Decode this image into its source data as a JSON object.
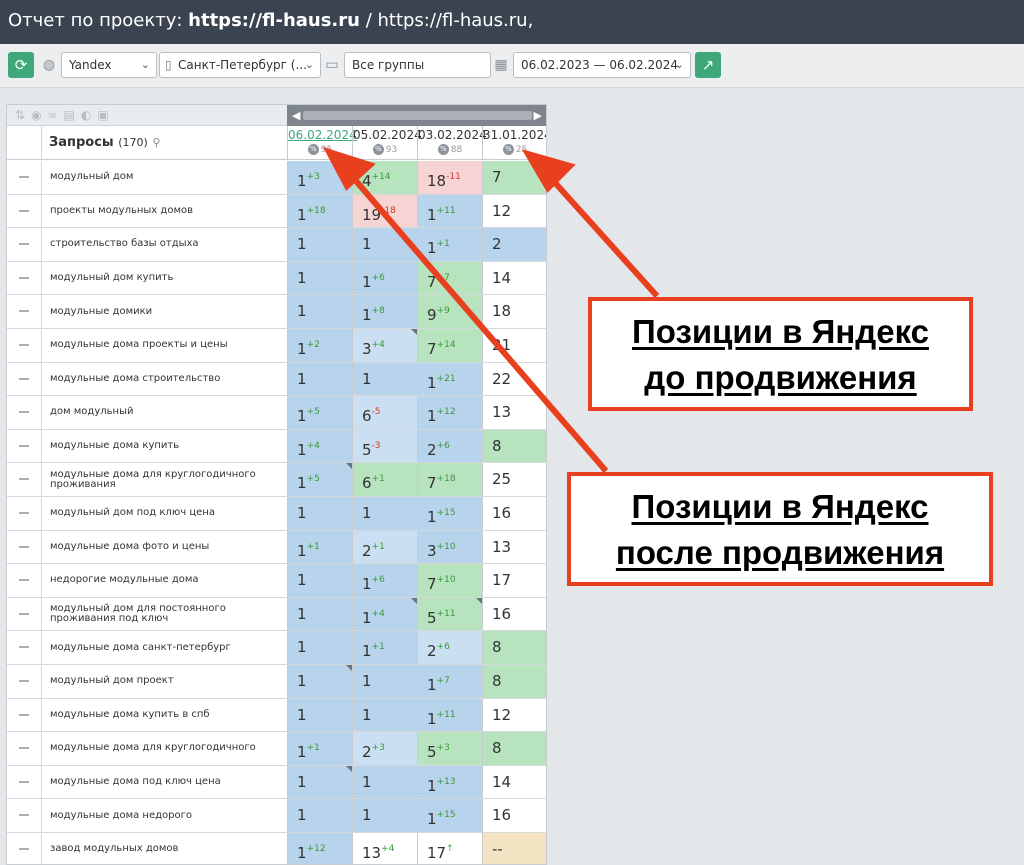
{
  "header": {
    "prefix": "Отчет по проекту: ",
    "project_bold": "https://fl-haus.ru",
    "project_rest": " / https://fl-haus.ru,"
  },
  "toolbar": {
    "search_engine": "Yandex",
    "region": "Санкт-Петербург (...",
    "group": "Все группы",
    "date_range": "06.02.2023 — 06.02.2024"
  },
  "table": {
    "query_header": "Запросы",
    "query_count": "(170)",
    "dates": [
      {
        "date": "06.02.2024",
        "pct": "95"
      },
      {
        "date": "05.02.2024",
        "pct": "93"
      },
      {
        "date": "03.02.2024",
        "pct": "88"
      },
      {
        "date": "31.01.2024",
        "pct": "25"
      }
    ],
    "rows": [
      {
        "q": "модульный дом",
        "cells": [
          {
            "v": "1",
            "d": "+3",
            "t": "up",
            "c": "c-blue"
          },
          {
            "v": "4",
            "d": "+14",
            "t": "up",
            "c": "c-green"
          },
          {
            "v": "18",
            "d": "-11",
            "t": "dn",
            "c": "c-pink"
          },
          {
            "v": "7",
            "c": "c-green"
          }
        ]
      },
      {
        "q": "проекты модульных домов",
        "cells": [
          {
            "v": "1",
            "d": "+18",
            "t": "up",
            "c": "c-blue"
          },
          {
            "v": "19",
            "d": "-18",
            "t": "dn",
            "c": "c-pink"
          },
          {
            "v": "1",
            "d": "+11",
            "t": "up",
            "c": "c-blue"
          },
          {
            "v": "12",
            "c": "c-white"
          }
        ]
      },
      {
        "q": "строительство базы отдыха",
        "cells": [
          {
            "v": "1",
            "c": "c-blue"
          },
          {
            "v": "1",
            "c": "c-blue"
          },
          {
            "v": "1",
            "d": "+1",
            "t": "up",
            "c": "c-blue"
          },
          {
            "v": "2",
            "c": "c-blue"
          }
        ]
      },
      {
        "q": "модульный дом купить",
        "cells": [
          {
            "v": "1",
            "c": "c-blue"
          },
          {
            "v": "1",
            "d": "+6",
            "t": "up",
            "c": "c-blue"
          },
          {
            "v": "7",
            "d": "+7",
            "t": "up",
            "c": "c-green"
          },
          {
            "v": "14",
            "c": "c-white"
          }
        ]
      },
      {
        "q": "модульные домики",
        "cells": [
          {
            "v": "1",
            "c": "c-blue"
          },
          {
            "v": "1",
            "d": "+8",
            "t": "up",
            "c": "c-blue"
          },
          {
            "v": "9",
            "d": "+9",
            "t": "up",
            "c": "c-green"
          },
          {
            "v": "18",
            "c": "c-white"
          }
        ]
      },
      {
        "q": "модульные дома проекты и цены",
        "cells": [
          {
            "v": "1",
            "d": "+2",
            "t": "up",
            "c": "c-blue"
          },
          {
            "v": "3",
            "d": "+4",
            "t": "up",
            "c": "c-lblue",
            "k": 1
          },
          {
            "v": "7",
            "d": "+14",
            "t": "up",
            "c": "c-green"
          },
          {
            "v": "21",
            "c": "c-white"
          }
        ]
      },
      {
        "q": "модульные дома строительство",
        "cells": [
          {
            "v": "1",
            "c": "c-blue"
          },
          {
            "v": "1",
            "c": "c-blue"
          },
          {
            "v": "1",
            "d": "+21",
            "t": "up",
            "c": "c-blue"
          },
          {
            "v": "22",
            "c": "c-white"
          }
        ]
      },
      {
        "q": "дом модульный",
        "cells": [
          {
            "v": "1",
            "d": "+5",
            "t": "up",
            "c": "c-blue"
          },
          {
            "v": "6",
            "d": "-5",
            "t": "dn",
            "c": "c-lblue"
          },
          {
            "v": "1",
            "d": "+12",
            "t": "up",
            "c": "c-blue"
          },
          {
            "v": "13",
            "c": "c-white"
          }
        ]
      },
      {
        "q": "модульные дома купить",
        "cells": [
          {
            "v": "1",
            "d": "+4",
            "t": "up",
            "c": "c-blue"
          },
          {
            "v": "5",
            "d": "-3",
            "t": "dn",
            "c": "c-lblue"
          },
          {
            "v": "2",
            "d": "+6",
            "t": "up",
            "c": "c-blue"
          },
          {
            "v": "8",
            "c": "c-green"
          }
        ]
      },
      {
        "q": "модульные дома для круглогодичного проживания",
        "cells": [
          {
            "v": "1",
            "d": "+5",
            "t": "up",
            "c": "c-blue",
            "k": 1
          },
          {
            "v": "6",
            "d": "+1",
            "t": "up",
            "c": "c-green"
          },
          {
            "v": "7",
            "d": "+18",
            "t": "up",
            "c": "c-green"
          },
          {
            "v": "25",
            "c": "c-white"
          }
        ]
      },
      {
        "q": "модульный дом под ключ цена",
        "cells": [
          {
            "v": "1",
            "c": "c-blue"
          },
          {
            "v": "1",
            "c": "c-blue"
          },
          {
            "v": "1",
            "d": "+15",
            "t": "up",
            "c": "c-blue"
          },
          {
            "v": "16",
            "c": "c-white"
          }
        ]
      },
      {
        "q": "модульные дома фото и цены",
        "cells": [
          {
            "v": "1",
            "d": "+1",
            "t": "up",
            "c": "c-blue"
          },
          {
            "v": "2",
            "d": "+1",
            "t": "up",
            "c": "c-lblue"
          },
          {
            "v": "3",
            "d": "+10",
            "t": "up",
            "c": "c-blue"
          },
          {
            "v": "13",
            "c": "c-white"
          }
        ]
      },
      {
        "q": "недорогие модульные дома",
        "cells": [
          {
            "v": "1",
            "c": "c-blue"
          },
          {
            "v": "1",
            "d": "+6",
            "t": "up",
            "c": "c-blue"
          },
          {
            "v": "7",
            "d": "+10",
            "t": "up",
            "c": "c-green"
          },
          {
            "v": "17",
            "c": "c-white"
          }
        ]
      },
      {
        "q": "модульный дом для постоянного проживания под ключ",
        "cells": [
          {
            "v": "1",
            "c": "c-blue"
          },
          {
            "v": "1",
            "d": "+4",
            "t": "up",
            "c": "c-blue",
            "k": 1
          },
          {
            "v": "5",
            "d": "+11",
            "t": "up",
            "c": "c-green",
            "k": 1
          },
          {
            "v": "16",
            "c": "c-white"
          }
        ]
      },
      {
        "q": "модульные дома санкт-петербург",
        "cells": [
          {
            "v": "1",
            "c": "c-blue"
          },
          {
            "v": "1",
            "d": "+1",
            "t": "up",
            "c": "c-blue"
          },
          {
            "v": "2",
            "d": "+6",
            "t": "up",
            "c": "c-lblue"
          },
          {
            "v": "8",
            "c": "c-green"
          }
        ]
      },
      {
        "q": "модульный дом проект",
        "cells": [
          {
            "v": "1",
            "c": "c-blue",
            "k": 1
          },
          {
            "v": "1",
            "c": "c-blue"
          },
          {
            "v": "1",
            "d": "+7",
            "t": "up",
            "c": "c-blue"
          },
          {
            "v": "8",
            "c": "c-green"
          }
        ]
      },
      {
        "q": "модульные дома купить в спб",
        "cells": [
          {
            "v": "1",
            "c": "c-blue"
          },
          {
            "v": "1",
            "c": "c-blue"
          },
          {
            "v": "1",
            "d": "+11",
            "t": "up",
            "c": "c-blue"
          },
          {
            "v": "12",
            "c": "c-white"
          }
        ]
      },
      {
        "q": "модульные дома для круглогодичного",
        "cells": [
          {
            "v": "1",
            "d": "+1",
            "t": "up",
            "c": "c-blue"
          },
          {
            "v": "2",
            "d": "+3",
            "t": "up",
            "c": "c-lblue"
          },
          {
            "v": "5",
            "d": "+3",
            "t": "up",
            "c": "c-green"
          },
          {
            "v": "8",
            "c": "c-green"
          }
        ]
      },
      {
        "q": "модульные дома под ключ цена",
        "cells": [
          {
            "v": "1",
            "c": "c-blue",
            "k": 1
          },
          {
            "v": "1",
            "c": "c-blue"
          },
          {
            "v": "1",
            "d": "+13",
            "t": "up",
            "c": "c-blue"
          },
          {
            "v": "14",
            "c": "c-white"
          }
        ]
      },
      {
        "q": "модульные дома недорого",
        "cells": [
          {
            "v": "1",
            "c": "c-blue"
          },
          {
            "v": "1",
            "c": "c-blue"
          },
          {
            "v": "1",
            "d": "+15",
            "t": "up",
            "c": "c-blue"
          },
          {
            "v": "16",
            "c": "c-white"
          }
        ]
      },
      {
        "q": "завод модульных домов",
        "cells": [
          {
            "v": "1",
            "d": "+12",
            "t": "up",
            "c": "c-blue"
          },
          {
            "v": "13",
            "d": "+4",
            "t": "up",
            "c": "c-white"
          },
          {
            "v": "17",
            "d": "↑",
            "t": "up",
            "c": "c-white"
          },
          {
            "v": "--",
            "c": "c-tan"
          }
        ]
      }
    ]
  },
  "annotations": {
    "before": [
      "Позиции в Яндекс",
      "до продвижения"
    ],
    "after": [
      "Позиции в Яндекс",
      "после продвижения"
    ]
  },
  "colors": {
    "accent_green": "#3ea87a",
    "callout_border": "#e8401f",
    "header_bg": "#3a4450"
  },
  "icons": [
    "refresh-icon",
    "globe-icon",
    "phone-icon",
    "folder-icon",
    "calendar-icon",
    "export-icon",
    "sort-icon",
    "search-icon",
    "percent-icon"
  ]
}
